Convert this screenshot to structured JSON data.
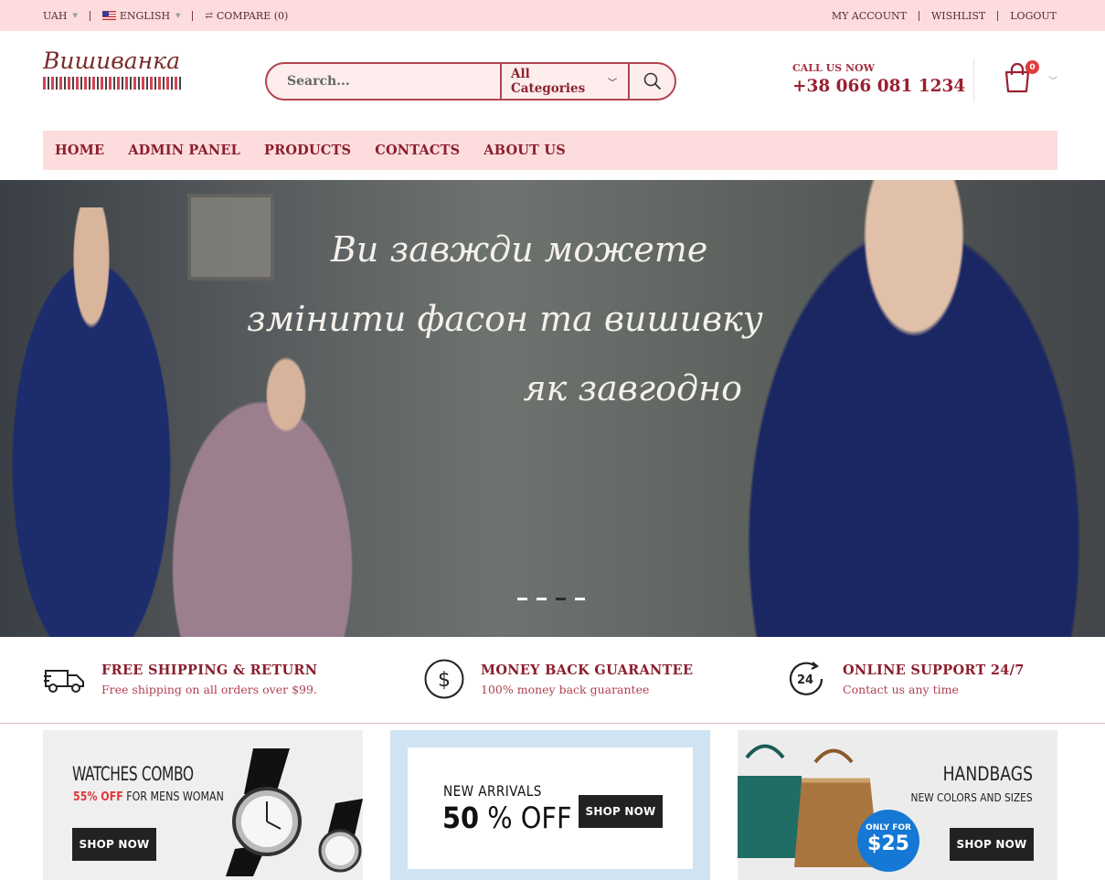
{
  "topbar": {
    "currency": "UAH",
    "language": "ENGLISH",
    "compare": "COMPARE (0)",
    "links": [
      "MY ACCOUNT",
      "WISHLIST",
      "LOGOUT"
    ]
  },
  "logo": {
    "text": "Вишиванка"
  },
  "search": {
    "placeholder": "Search...",
    "category": "All Categories"
  },
  "call": {
    "label": "CALL US NOW",
    "number": "+38 066 081 1234"
  },
  "cart": {
    "count": "0"
  },
  "nav": [
    "HOME",
    "ADMIN PANEL",
    "PRODUCTS",
    "CONTACTS",
    "ABOUT US"
  ],
  "hero": {
    "lines": [
      "Ви завжди можете",
      "змінити фасон та вишивку",
      "як завгодно"
    ],
    "active_slide": 3,
    "slide_count": 4
  },
  "features": [
    {
      "icon": "truck-icon",
      "title": "FREE SHIPPING & RETURN",
      "subtitle": "Free shipping on all orders over $99."
    },
    {
      "icon": "dollar-icon",
      "title": "MONEY BACK GUARANTEE",
      "subtitle": "100% money back guarantee"
    },
    {
      "icon": "support-24-icon",
      "title": "ONLINE SUPPORT 24/7",
      "subtitle": "Contact us any time"
    }
  ],
  "banners": {
    "watches": {
      "title": "WATCHES COMBO",
      "discount": "55% OFF",
      "subtitle_rest": " FOR MENS WOMAN",
      "button": "SHOP NOW"
    },
    "arrivals": {
      "title": "NEW ARRIVALS",
      "percent": "50",
      "off": " % OFF",
      "button": "SHOP NOW"
    },
    "handbags": {
      "title": "HANDBAGS",
      "subtitle": "NEW COLORS AND SIZES",
      "price_label": "ONLY FOR",
      "price": "$25",
      "button": "SHOP NOW"
    }
  },
  "colors": {
    "accent": "#8b1e2d",
    "topbar_bg": "#fcdcdc",
    "badge": "#e23b3b"
  }
}
